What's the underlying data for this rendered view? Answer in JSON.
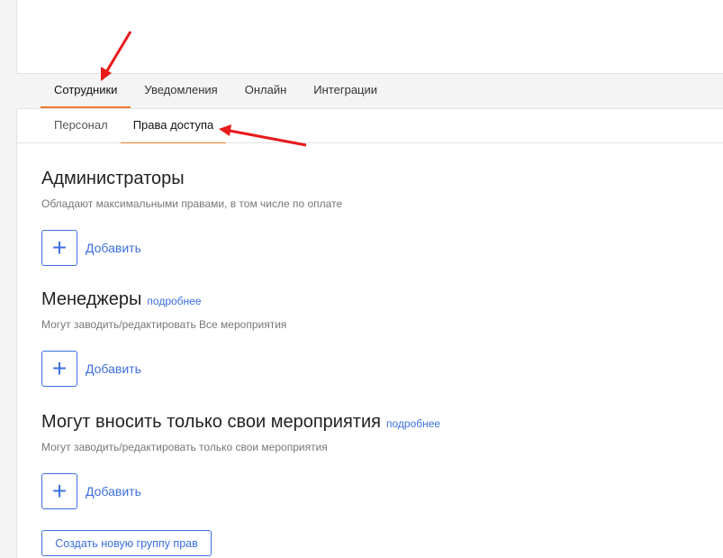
{
  "tabs": [
    "Сотрудники",
    "Уведомления",
    "Онлайн",
    "Интеграции"
  ],
  "subtabs": [
    "Персонал",
    "Права доступа"
  ],
  "sections": [
    {
      "title": "Администраторы",
      "more": "",
      "desc": "Обладают максимальными правами, в том числе по оплате",
      "add": "Добавить"
    },
    {
      "title": "Менеджеры",
      "more": "подробнее",
      "desc": "Могут заводить/редактировать Все мероприятия",
      "add": "Добавить"
    },
    {
      "title": "Могут вносить только свои мероприятия",
      "more": "подробнее",
      "desc": "Могут заводить/редактировать только свои мероприятия",
      "add": "Добавить"
    }
  ],
  "plus_symbol": "+",
  "create_button": "Создать новую группу прав",
  "colors": {
    "accent": "#3c6fe0",
    "active_tab": "#f07a2b",
    "annotation": "#e8191b"
  }
}
